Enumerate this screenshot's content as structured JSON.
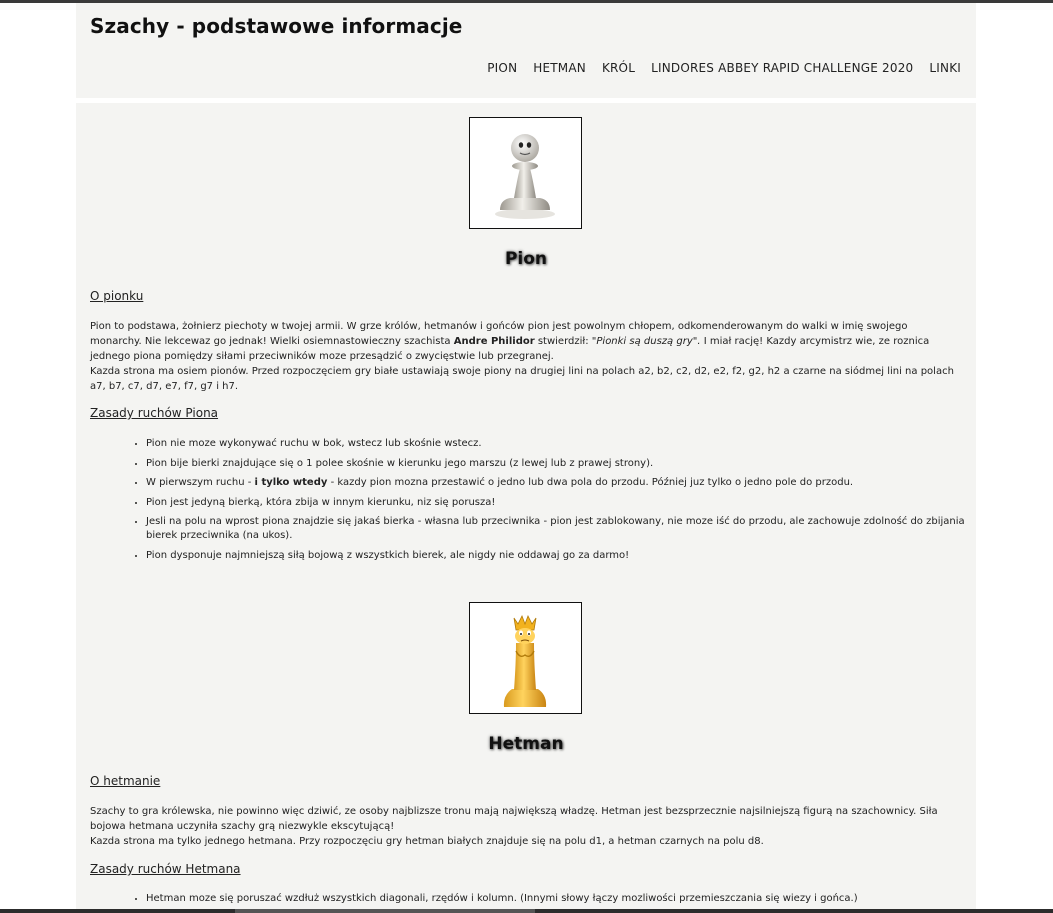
{
  "site": {
    "title": "Szachy - podstawowe informacje"
  },
  "nav": [
    "PION",
    "HETMAN",
    "KRÓL",
    "LINDORES ABBEY RAPID CHALLENGE 2020",
    "LINKI"
  ],
  "pawn": {
    "image": "pawn-piece-icon",
    "heading": "Pion",
    "about_heading": "O pionku",
    "p1_a": "Pion to podstawa, żołnierz piechoty w twojej armii. W grze królów, hetmanów i gońców pion jest powolnym chłopem, odkomenderowanym do walki w imię swojego monarchy. Nie lekcewaz go jednak! Wielki osiemnastowieczny szachista ",
    "p1_name": "Andre Philidor",
    "p1_b": " stwierdził: ",
    "p1_quote": "\"Pionki są duszą gry\".",
    "p1_c": " I miał rację! Kazdy arcymistrz wie, ze roznica jednego piona pomiędzy siłami przeciwników moze przesądzić o zwycięstwie lub przegranej.",
    "p2": "Kazda strona ma osiem pionów. Przed rozpoczęciem gry białe ustawiają swoje piony na drugiej lini na polach a2, b2, c2, d2, e2, f2, g2, h2 a czarne na siódmej lini na polach a7, b7, c7, d7, e7, f7, g7 i h7.",
    "rules_heading": "Zasady ruchów Piona",
    "rule1": "Pion nie moze wykonywać ruchu w bok, wstecz lub skośnie wstecz.",
    "rule2": "Pion bije bierki znajdujące się o 1 polee skośnie w kierunku jego marszu (z lewej lub z prawej strony).",
    "rule3_a": "W pierwszym ruchu - ",
    "rule3_b": "i tylko wtedy",
    "rule3_c": " - kazdy pion mozna przestawić o jedno lub dwa pola do przodu. Później juz tylko o jedno pole do przodu.",
    "rule4": "Pion jest jedyną bierką, która zbija w innym kierunku, niz się porusza!",
    "rule5": "Jesli na polu na wprost piona znajdzie się jakaś bierka - własna lub przeciwnika - pion jest zablokowany, nie moze iść do przodu, ale zachowuje zdolność do zbijania bierek przeciwnika (na ukos).",
    "rule6": "Pion dysponuje najmniejszą siłą bojową z wszystkich bierek, ale nigdy nie oddawaj go za darmo!"
  },
  "queen": {
    "image": "queen-piece-icon",
    "heading": "Hetman",
    "about_heading": "O hetmanie",
    "p1": "Szachy to gra królewska, nie powinno więc dziwić, ze osoby najblizsze tronu mają największą władzę. Hetman jest bezsprzecznie najsilniejszą figurą na szachownicy. Siła bojowa hetmana uczyniła szachy grą niezwykle ekscytującą!",
    "p2": "Kazda strona ma tylko jednego hetmana. Przy rozpoczęciu gry hetman białych znajduje się na polu d1, a hetman czarnych na polu d8.",
    "rules_heading": "Zasady ruchów Hetmana",
    "rule1": "Hetman moze się poruszać wzdłuż wszystkich diagonali, rzędów i kolumn. (Innymi słowy łączy mozliwości przemieszczania się wiezy i gońca.)"
  }
}
